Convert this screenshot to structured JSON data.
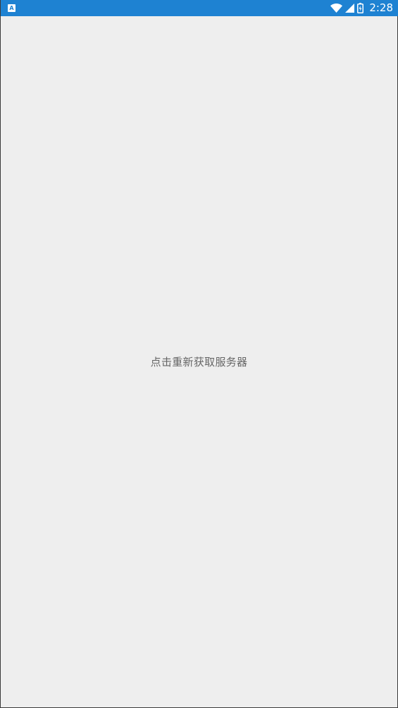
{
  "status_bar": {
    "notification_icon": "app-notification-icon",
    "notification_glyph": "A",
    "wifi_icon": "wifi-icon",
    "signal_icon": "cell-signal-icon",
    "battery_icon": "battery-icon",
    "time": "2:28",
    "background_color": "#1e82d2"
  },
  "main": {
    "refresh_label": "点击重新获取服务器",
    "background_color": "#eeeeee",
    "text_color": "#666666"
  }
}
